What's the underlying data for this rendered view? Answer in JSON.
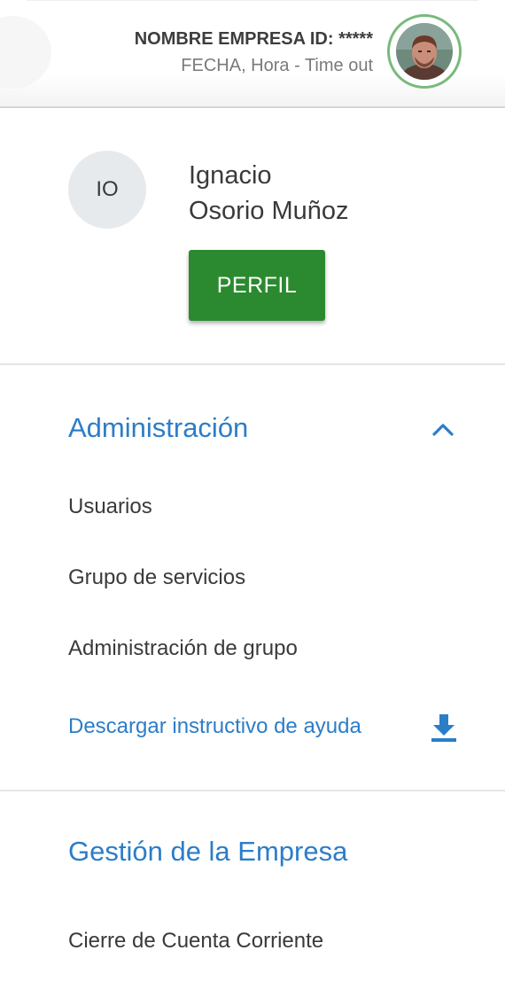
{
  "header": {
    "company": "NOMBRE EMPRESA ID: *****",
    "session": "FECHA, Hora - Time out",
    "avatar_icon": "user-photo"
  },
  "profile": {
    "initials": "IO",
    "first_name": "Ignacio",
    "last_name": "Osorio Muñoz",
    "button_label": "PERFIL",
    "button_color": "#2b8a2f"
  },
  "menu": {
    "admin": {
      "title": "Administración",
      "expanded_icon": "chevron-up-icon",
      "items": [
        "Usuarios",
        "Grupo de servicios",
        "Administración de grupo"
      ],
      "help_link": "Descargar instructivo de ayuda",
      "help_icon": "download-icon"
    },
    "company": {
      "title": "Gestión de la Empresa",
      "items": [
        "Cierre de Cuenta Corriente"
      ]
    }
  },
  "colors": {
    "accent": "#2c7dc8",
    "avatar_ring": "#79ba7c"
  }
}
